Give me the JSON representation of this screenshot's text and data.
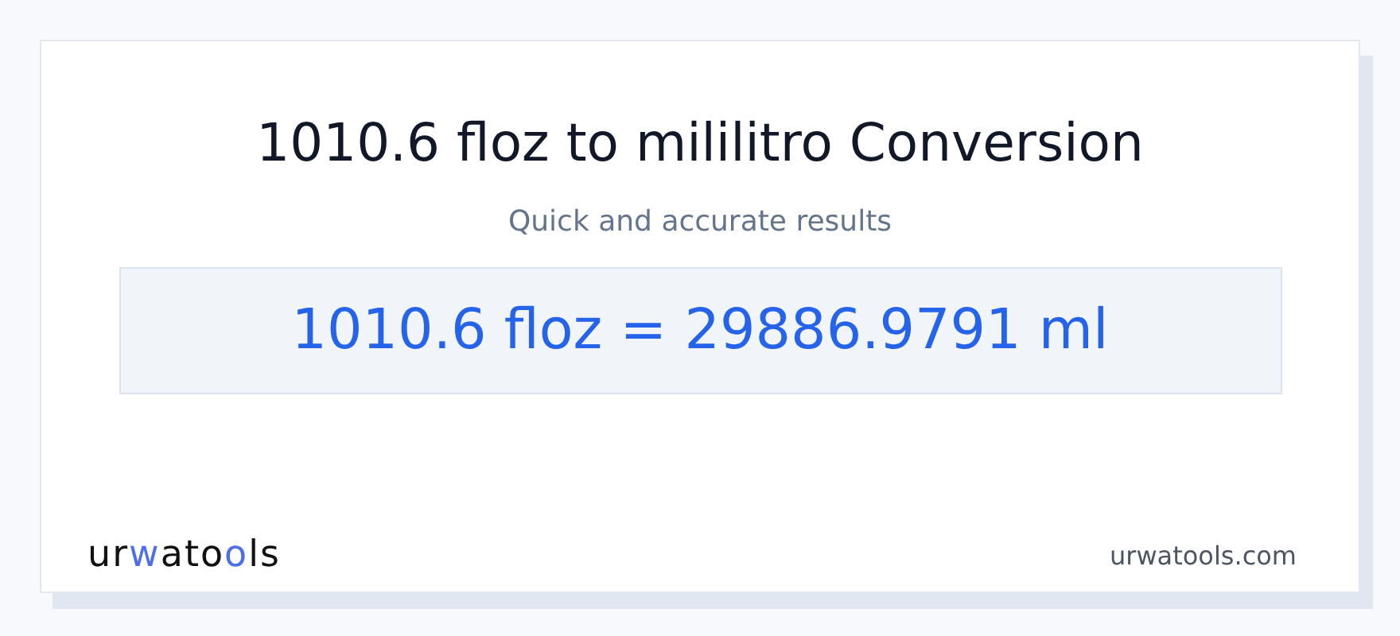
{
  "title": "1010.6 floz to mililitro Conversion",
  "subtitle": "Quick and accurate results",
  "result": "1010.6 floz = 29886.9791 ml",
  "logo": [
    {
      "text": "ur",
      "accent": false
    },
    {
      "text": "w",
      "accent": true
    },
    {
      "text": "ato",
      "accent": false
    },
    {
      "text": "o",
      "accent": true
    },
    {
      "text": "ls",
      "accent": false
    }
  ],
  "site": "urwatools.com"
}
